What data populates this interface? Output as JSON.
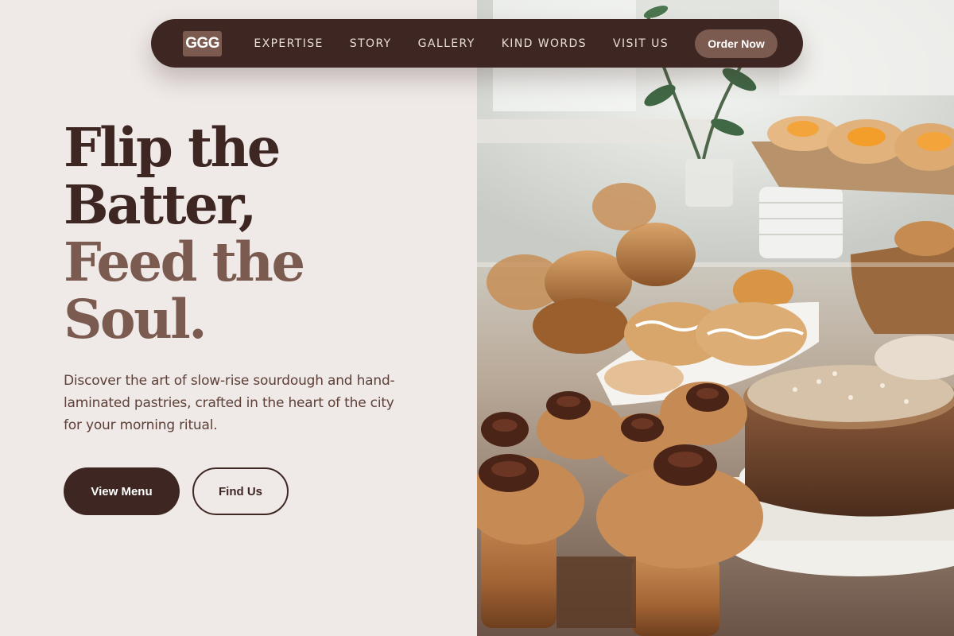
{
  "nav": {
    "logo": "GGG",
    "links": [
      "EXPERTISE",
      "STORY",
      "GALLERY",
      "KIND WORDS",
      "VISIT US"
    ],
    "cta": "Order Now"
  },
  "hero": {
    "title_line1": "Flip the",
    "title_line2": "Batter,",
    "title_line3": "Feed the",
    "title_line4": "Soul.",
    "description": "Discover the art of slow-rise sourdough and hand-laminated pastries, crafted in the heart of the city for your morning ritual.",
    "primary_button": "View Menu",
    "secondary_button": "Find Us"
  },
  "colors": {
    "primary": "#3e2723",
    "accent": "#7b5a4f",
    "background": "#efe9e7"
  }
}
